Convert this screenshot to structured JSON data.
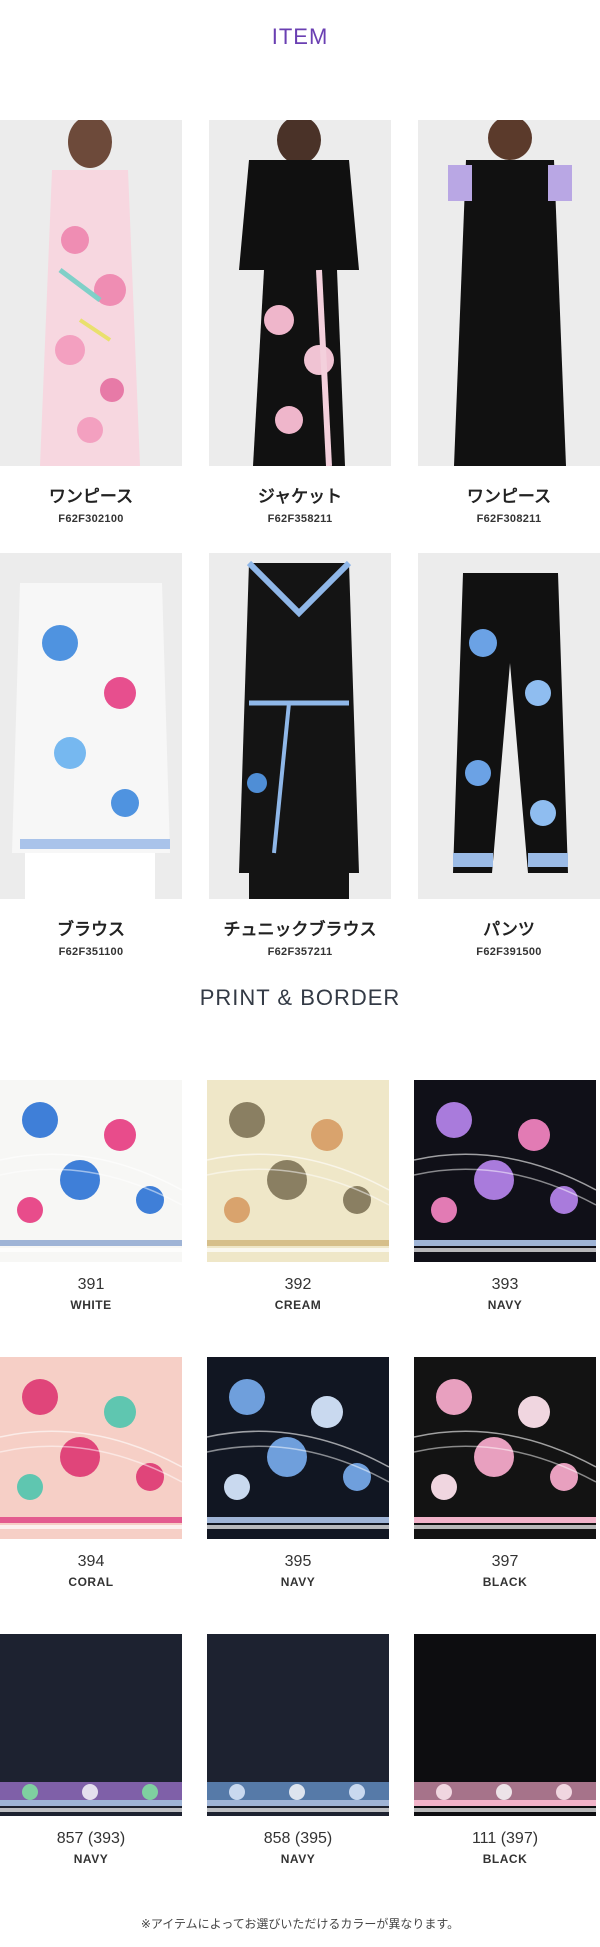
{
  "headings": {
    "item": "ITEM",
    "print": "PRINT & BORDER"
  },
  "items": [
    {
      "name": "ワンピース",
      "code": "F62F302100"
    },
    {
      "name": "ジャケット",
      "code": "F62F358211"
    },
    {
      "name": "ワンピース",
      "code": "F62F308211"
    },
    {
      "name": "ブラウス",
      "code": "F62F351100"
    },
    {
      "name": "チュニックブラウス",
      "code": "F62F357211"
    },
    {
      "name": "パンツ",
      "code": "F62F391500"
    }
  ],
  "swatches": [
    {
      "number": "391",
      "color": "WHITE",
      "bg": "#f7f7f5",
      "flower": "#3f7fd8",
      "flower2": "#e84c8b",
      "border": "#9fb4d6"
    },
    {
      "number": "392",
      "color": "CREAM",
      "bg": "#efe7c8",
      "flower": "#8a7f62",
      "flower2": "#d9a36d",
      "border": "#d6bf8a"
    },
    {
      "number": "393",
      "color": "NAVY",
      "bg": "#101018",
      "flower": "#a97bdc",
      "flower2": "#e27bb4",
      "border": "#9fb4d6"
    },
    {
      "number": "394",
      "color": "CORAL",
      "bg": "#f6cfc6",
      "flower": "#e0457a",
      "flower2": "#5fc6b0",
      "border": "#e35c8f"
    },
    {
      "number": "395",
      "color": "NAVY",
      "bg": "#111622",
      "flower": "#6f9fdc",
      "flower2": "#c9d9ef",
      "border": "#9fb4d6"
    },
    {
      "number": "397",
      "color": "BLACK",
      "bg": "#131313",
      "flower": "#e8a0bf",
      "flower2": "#f0d6e0",
      "border": "#f1b3c9"
    },
    {
      "number": "857 (393)",
      "color": "NAVY",
      "bg": "#1d2230",
      "flower": "#a97bdc",
      "flower2": "#7fd0a0",
      "border": "#9fb4d6"
    },
    {
      "number": "858 (395)",
      "color": "NAVY",
      "bg": "#1d2230",
      "flower": "#6f9fdc",
      "flower2": "#c9d9ef",
      "border": "#9fb4d6"
    },
    {
      "number": "111 (397)",
      "color": "BLACK",
      "bg": "#0d0d10",
      "flower": "#e8a0bf",
      "flower2": "#f0d6e0",
      "border": "#f1b3c9"
    }
  ],
  "note": "※アイテムによってお選びいただけるカラーが異なります。"
}
